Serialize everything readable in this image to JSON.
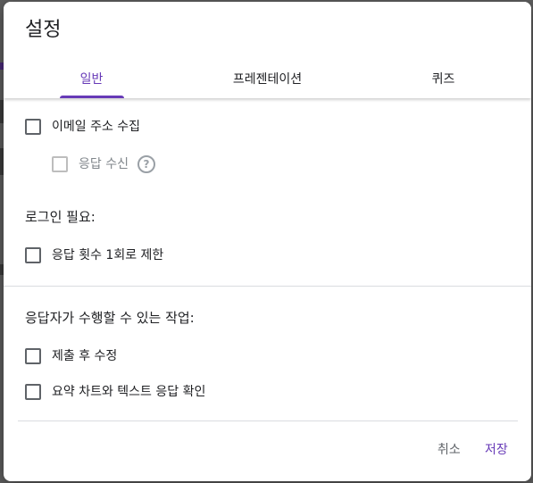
{
  "dialog": {
    "title": "설정"
  },
  "tabs": [
    {
      "label": "일반",
      "active": true
    },
    {
      "label": "프레젠테이션",
      "active": false
    },
    {
      "label": "퀴즈",
      "active": false
    }
  ],
  "general": {
    "collect_email": "이메일 주소 수집",
    "response_receipts": "응답 수신",
    "help_icon": "?",
    "login_required": "로그인 필요:",
    "limit_one_response": "응답 횟수 1회로 제한",
    "respondents_can": "응답자가 수행할 수 있는 작업:",
    "edit_after_submit": "제출 후 수정",
    "see_summary": "요약 차트와 텍스트 응답 확인"
  },
  "footer": {
    "cancel": "취소",
    "save": "저장"
  },
  "colors": {
    "accent": "#673ab7",
    "text": "#202124",
    "muted": "#80868b"
  }
}
